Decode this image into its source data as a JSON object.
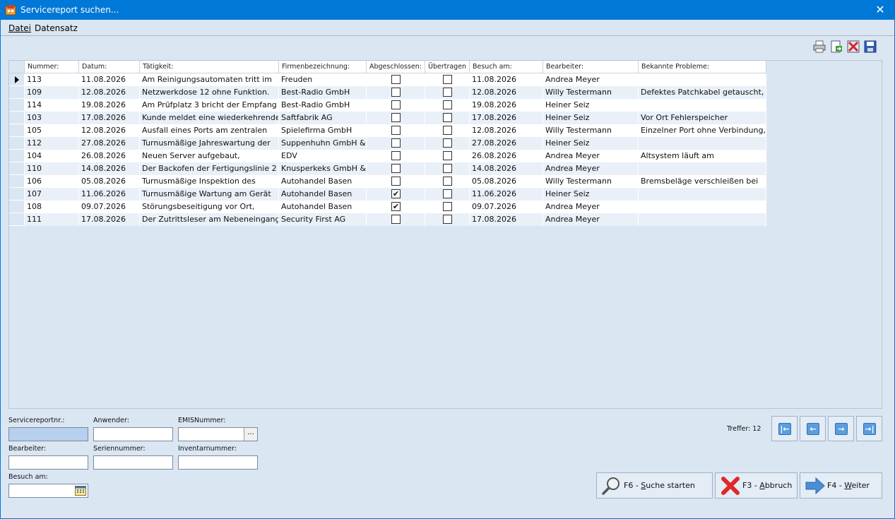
{
  "window": {
    "title": "Servicereport suchen...",
    "close": "✕"
  },
  "menu": {
    "file": "Datei",
    "record": "Datensatz"
  },
  "toolbar": {
    "icons": [
      "printer-icon",
      "export-icon",
      "delete-icon",
      "save-icon"
    ]
  },
  "grid": {
    "headers": [
      "Nummer:",
      "Datum:",
      "Tätigkeit:",
      "Firmenbezeichnung:",
      "Abgeschlossen:",
      "Übertragen",
      "Besuch am:",
      "Bearbeiter:",
      "Bekannte Probleme:"
    ],
    "rows": [
      {
        "nr": "113",
        "date": "11.08.2026",
        "activity": "Am Reinigungsautomaten tritt im",
        "company": "Freuden",
        "closed": false,
        "transferred": false,
        "visit": "11.08.2026",
        "editor": "Andrea Meyer",
        "problems": ""
      },
      {
        "nr": "109",
        "date": "12.08.2026",
        "activity": "Netzwerkdose 12 ohne Funktion.",
        "company": "Best-Radio GmbH",
        "closed": false,
        "transferred": false,
        "visit": "12.08.2026",
        "editor": "Willy Testermann",
        "problems": "Defektes Patchkabel getauscht,"
      },
      {
        "nr": "114",
        "date": "19.08.2026",
        "activity": "Am Prüfplatz 3 bricht der Empfang",
        "company": "Best-Radio GmbH",
        "closed": false,
        "transferred": false,
        "visit": "19.08.2026",
        "editor": "Heiner Seiz",
        "problems": ""
      },
      {
        "nr": "103",
        "date": "17.08.2026",
        "activity": "Kunde meldet eine wiederkehrende",
        "company": "Saftfabrik AG",
        "closed": false,
        "transferred": false,
        "visit": "17.08.2026",
        "editor": "Heiner Seiz",
        "problems": "Vor Ort Fehlerspeicher"
      },
      {
        "nr": "105",
        "date": "12.08.2026",
        "activity": "Ausfall eines Ports am zentralen",
        "company": "Spielefirma GmbH",
        "closed": false,
        "transferred": false,
        "visit": "12.08.2026",
        "editor": "Willy Testermann",
        "problems": "Einzelner Port ohne Verbindung,"
      },
      {
        "nr": "112",
        "date": "27.08.2026",
        "activity": "Turnusmäßige Jahreswartung der",
        "company": "Suppenhuhn GmbH &",
        "closed": false,
        "transferred": false,
        "visit": "27.08.2026",
        "editor": "Heiner Seiz",
        "problems": ""
      },
      {
        "nr": "104",
        "date": "26.08.2026",
        "activity": "Neuen Server aufgebaut,",
        "company": "EDV",
        "closed": false,
        "transferred": false,
        "visit": "26.08.2026",
        "editor": "Andrea Meyer",
        "problems": "Altsystem läuft am"
      },
      {
        "nr": "110",
        "date": "14.08.2026",
        "activity": "Der Backofen der Fertigungslinie 2",
        "company": "Knusperkeks GmbH &",
        "closed": false,
        "transferred": false,
        "visit": "14.08.2026",
        "editor": "Andrea Meyer",
        "problems": ""
      },
      {
        "nr": "106",
        "date": "05.08.2026",
        "activity": "Turnusmäßige Inspektion des",
        "company": "Autohandel Basen",
        "closed": false,
        "transferred": false,
        "visit": "05.08.2026",
        "editor": "Willy Testermann",
        "problems": "Bremsbeläge verschleißen bei"
      },
      {
        "nr": "107",
        "date": "11.06.2026",
        "activity": "Turnusmäßige Wartung am Gerät",
        "company": "Autohandel Basen",
        "closed": true,
        "transferred": false,
        "visit": "11.06.2026",
        "editor": "Heiner Seiz",
        "problems": ""
      },
      {
        "nr": "108",
        "date": "09.07.2026",
        "activity": "Störungsbeseitigung vor Ort,",
        "company": "Autohandel Basen",
        "closed": true,
        "transferred": false,
        "visit": "09.07.2026",
        "editor": "Andrea Meyer",
        "problems": ""
      },
      {
        "nr": "111",
        "date": "17.08.2026",
        "activity": "Der Zutrittsleser am Nebeneingang",
        "company": "Security First AG",
        "closed": false,
        "transferred": false,
        "visit": "17.08.2026",
        "editor": "Andrea Meyer",
        "problems": ""
      }
    ],
    "check_mark": "✔"
  },
  "search": {
    "report_nr_label": "Servicereportnr.:",
    "report_nr_value": "",
    "user_label": "Anwender:",
    "user_value": "",
    "emis_label": "EMISNummer:",
    "emis_value": "",
    "emis_button": "...",
    "editor_label": "Bearbeiter:",
    "editor_value": "",
    "serial_label": "Seriennummer:",
    "serial_value": "",
    "inventory_label": "Inventarnummer:",
    "inventory_value": "",
    "visit_label": "Besuch am:",
    "visit_value": ""
  },
  "results": {
    "hits": "Treffer: 12"
  },
  "buttons": {
    "search_prefix": "F6 - ",
    "search_access": "S",
    "search_rest": "uche starten",
    "cancel_prefix": "F3 - ",
    "cancel_access": "A",
    "cancel_rest": "bbruch",
    "next_prefix": "F4 - ",
    "next_access": "W",
    "next_rest": "eiter"
  },
  "colors": {
    "titlebar": "#0078d7",
    "window_bg": "#dbe6f3",
    "row_alt": "#e9f0f8"
  }
}
